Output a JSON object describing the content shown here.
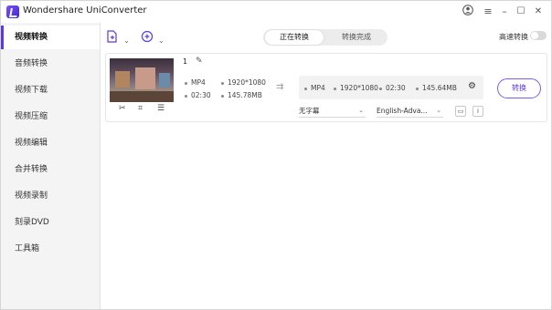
{
  "app": {
    "title": "Wondershare UniConverter"
  },
  "window_controls": {
    "account_icon": "user-circle-icon",
    "menu_icon": "hamburger-icon",
    "minimize": "–",
    "maximize": "☐",
    "close": "✕"
  },
  "sidebar": {
    "items": [
      {
        "label": "视频转换",
        "active": true
      },
      {
        "label": "音频转换",
        "active": false
      },
      {
        "label": "视频下载",
        "active": false
      },
      {
        "label": "视频压缩",
        "active": false
      },
      {
        "label": "视频编辑",
        "active": false
      },
      {
        "label": "合并转换",
        "active": false
      },
      {
        "label": "视频录制",
        "active": false
      },
      {
        "label": "刻录DVD",
        "active": false
      },
      {
        "label": "工具箱",
        "active": false
      }
    ]
  },
  "toolbar": {
    "add_file_icon": "add-file-icon",
    "add_media_icon": "add-media-icon",
    "tabs": [
      {
        "label": "正在转换"
      },
      {
        "label": "转换完成"
      }
    ],
    "high_speed_label": "高速转换",
    "high_speed_on": false
  },
  "file": {
    "index": "1",
    "source": {
      "format": "MP4",
      "resolution": "1920*1080",
      "duration": "02:30",
      "size": "145.78MB"
    },
    "output": {
      "format": "MP4",
      "resolution": "1920*1080",
      "duration": "02:30",
      "size": "145.64MB"
    },
    "subtitle_select": "无字幕",
    "audio_select": "English-Adva...",
    "convert_label": "转换"
  },
  "colors": {
    "accent": "#5a3dd8",
    "sidebar_bg": "#f4f4f4"
  }
}
